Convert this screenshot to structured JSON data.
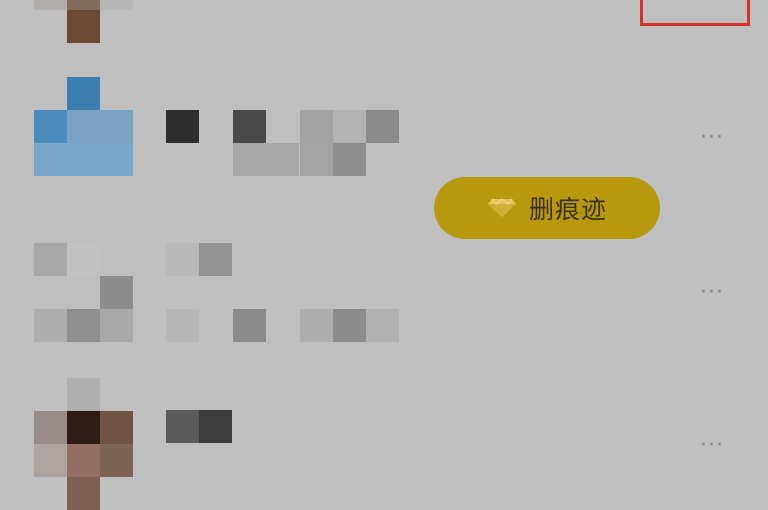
{
  "top_action": {
    "highlighted": true,
    "highlight_color": "#d6312a"
  },
  "rows": [
    {
      "avatar": "pixelated-avatar",
      "name": "",
      "has_pill_action": false
    },
    {
      "avatar": "pixelated-blue-avatar",
      "name": "",
      "has_pill_action": true,
      "pill_label": "删痕迹",
      "pill_icon": "diamond-icon",
      "more_label": "···"
    },
    {
      "avatar": "pixelated-gray-avatar",
      "name": "",
      "has_pill_action": false,
      "more_label": "···"
    },
    {
      "avatar": "pixelated-brown-avatar",
      "name": "",
      "has_pill_action": false,
      "more_label": "···"
    }
  ],
  "colors": {
    "background": "#bfbfbf",
    "pill": "#b8990e",
    "pill_text": "#3b3213",
    "more_text": "#8a8a8a"
  }
}
